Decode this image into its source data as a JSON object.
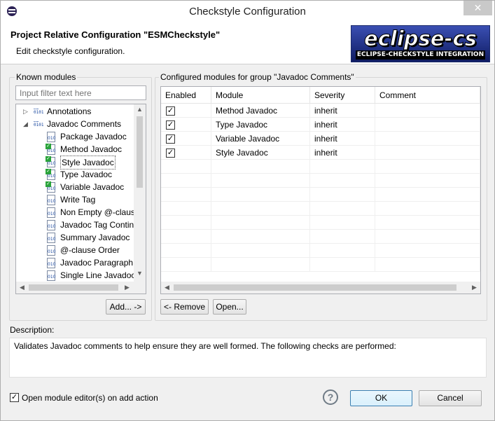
{
  "window": {
    "title": "Checkstyle Configuration",
    "close_glyph": "✕"
  },
  "header": {
    "title": "Project Relative Configuration \"ESMCheckstyle\"",
    "subtitle": "Edit checkstyle configuration.",
    "logo_main": "eclipse-cs",
    "logo_band": "ECLIPSE-CHECKSTYLE INTEGRATION"
  },
  "known_modules": {
    "label": "Known modules",
    "filter_placeholder": "Input filter text here",
    "tree": [
      {
        "label": "Annotations",
        "kind": "category",
        "expander": "▷",
        "checked": false
      },
      {
        "label": "Javadoc Comments",
        "kind": "category",
        "expander": "◢",
        "checked": false
      },
      {
        "label": "Package Javadoc",
        "kind": "module",
        "checked": false
      },
      {
        "label": "Method Javadoc",
        "kind": "module",
        "checked": true
      },
      {
        "label": "Style Javadoc",
        "kind": "module",
        "checked": true,
        "selected": true
      },
      {
        "label": "Type Javadoc",
        "kind": "module",
        "checked": true
      },
      {
        "label": "Variable Javadoc",
        "kind": "module",
        "checked": true
      },
      {
        "label": "Write Tag",
        "kind": "module",
        "checked": false
      },
      {
        "label": "Non Empty @-claus",
        "kind": "module",
        "checked": false
      },
      {
        "label": "Javadoc Tag Contin",
        "kind": "module",
        "checked": false
      },
      {
        "label": "Summary Javadoc",
        "kind": "module",
        "checked": false
      },
      {
        "label": "@-clause Order",
        "kind": "module",
        "checked": false
      },
      {
        "label": "Javadoc Paragraph",
        "kind": "module",
        "checked": false
      },
      {
        "label": "Single Line Javadoc",
        "kind": "module",
        "checked": false
      }
    ],
    "add_button": "Add... ->"
  },
  "configured": {
    "label": "Configured modules for group \"Javadoc Comments\"",
    "columns": [
      "Enabled",
      "Module",
      "Severity",
      "Comment"
    ],
    "rows": [
      {
        "enabled": true,
        "module": "Method Javadoc",
        "severity": "inherit",
        "comment": ""
      },
      {
        "enabled": true,
        "module": "Type Javadoc",
        "severity": "inherit",
        "comment": ""
      },
      {
        "enabled": true,
        "module": "Variable Javadoc",
        "severity": "inherit",
        "comment": ""
      },
      {
        "enabled": true,
        "module": "Style Javadoc",
        "severity": "inherit",
        "comment": ""
      }
    ],
    "remove_button": "<- Remove",
    "open_button": "Open..."
  },
  "description": {
    "label": "Description:",
    "text": "Validates Javadoc comments to help ensure they are well formed. The following checks are performed:"
  },
  "footer": {
    "open_editor_label": "Open module editor(s) on add action",
    "open_editor_checked": true,
    "ok": "OK",
    "cancel": "Cancel",
    "help_glyph": "?"
  },
  "colors": {
    "accent_border": "#3c7fb1",
    "check_green": "#2aa43a",
    "logo_blue": "#1b2a6a"
  }
}
